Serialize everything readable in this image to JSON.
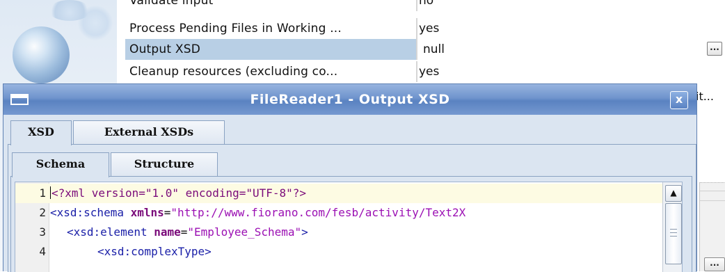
{
  "properties": {
    "rows": [
      {
        "name": "Validate input",
        "value": "no"
      },
      {
        "name": "Process Pending Files in Working ...",
        "value": "yes"
      },
      {
        "name": "Output XSD",
        "value": "null"
      },
      {
        "name": "Cleanup resources (excluding co...",
        "value": "yes"
      }
    ],
    "partial_value": "it...",
    "ellipsis_label": "...",
    "bottom_ellipsis_label": "..."
  },
  "dialog": {
    "title": "FileReader1 - Output XSD",
    "close_label": "x",
    "outer_tabs": [
      {
        "label": "XSD"
      },
      {
        "label": "External XSDs"
      }
    ],
    "inner_tabs": [
      {
        "label": "Schema"
      },
      {
        "label": "Structure"
      }
    ],
    "editor": {
      "lines": [
        {
          "num": "1",
          "parts": [
            "<?xml version=\"1.0\" encoding=\"UTF-8\"?>"
          ]
        },
        {
          "num": "2",
          "parts": [
            "<xsd:schema",
            " ",
            "xmlns",
            "=",
            "\"http://www.fiorano.com/fesb/activity/Text2X"
          ]
        },
        {
          "num": "3",
          "parts": [
            "<xsd:element",
            " ",
            "name",
            "=",
            "\"Employee_Schema\"",
            ">"
          ]
        },
        {
          "num": "4",
          "parts": [
            "<xsd:complexType>"
          ]
        }
      ]
    },
    "scroll_up_label": "▲"
  },
  "colors": {
    "titlebar": "#6f94cd",
    "selected_row": "#b8cfe5",
    "current_line": "#fdfbe3",
    "xml_tag": "#1b20a8",
    "xml_string": "#9b0fb3"
  }
}
